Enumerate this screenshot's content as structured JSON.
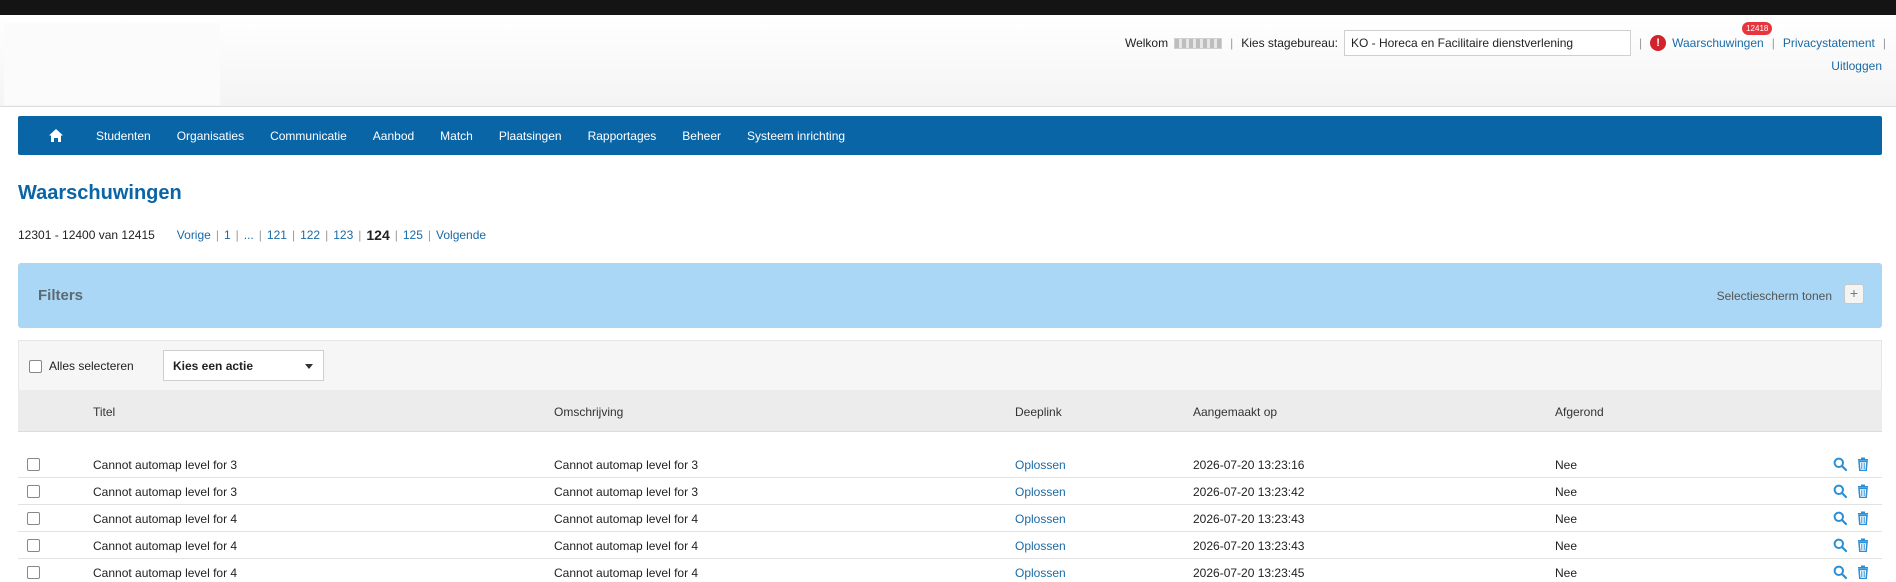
{
  "header": {
    "welcome_label": "Welkom",
    "bureau_label": "Kies stagebureau:",
    "bureau_value": "KO - Horeca en Facilitaire dienstverlening",
    "warnings_label": "Waarschuwingen",
    "warnings_count": "12418",
    "privacy_label": "Privacystatement",
    "logout_label": "Uitloggen"
  },
  "nav": {
    "home_icon": "home-icon",
    "items": [
      "Studenten",
      "Organisaties",
      "Communicatie",
      "Aanbod",
      "Match",
      "Plaatsingen",
      "Rapportages",
      "Beheer",
      "Systeem inrichting"
    ]
  },
  "page": {
    "title": "Waarschuwingen"
  },
  "pager": {
    "range": "12301 - 12400 van 12415",
    "prev": "Vorige",
    "first": "1",
    "ellipsis": "...",
    "pages": [
      "121",
      "122",
      "123"
    ],
    "current": "124",
    "after": "125",
    "next": "Volgende"
  },
  "filters": {
    "title": "Filters",
    "toggle_label": "Selectiescherm tonen",
    "plus_symbol": "+"
  },
  "actions": {
    "select_all_label": "Alles selecteren",
    "action_select_value": "Kies een actie"
  },
  "table": {
    "columns": {
      "titel": "Titel",
      "omschrijving": "Omschrijving",
      "deeplink": "Deeplink",
      "aangemaakt": "Aangemaakt op",
      "afgerond": "Afgerond"
    },
    "rows": [
      {
        "titel": "Cannot automap level for 3",
        "omschrijving": "Cannot automap level for 3",
        "deeplink": "Oplossen",
        "aangemaakt": "2026-07-20 13:23:16",
        "afgerond": "Nee"
      },
      {
        "titel": "Cannot automap level for 3",
        "omschrijving": "Cannot automap level for 3",
        "deeplink": "Oplossen",
        "aangemaakt": "2026-07-20 13:23:42",
        "afgerond": "Nee"
      },
      {
        "titel": "Cannot automap level for 4",
        "omschrijving": "Cannot automap level for 4",
        "deeplink": "Oplossen",
        "aangemaakt": "2026-07-20 13:23:43",
        "afgerond": "Nee"
      },
      {
        "titel": "Cannot automap level for 4",
        "omschrijving": "Cannot automap level for 4",
        "deeplink": "Oplossen",
        "aangemaakt": "2026-07-20 13:23:43",
        "afgerond": "Nee"
      },
      {
        "titel": "Cannot automap level for 4",
        "omschrijving": "Cannot automap level for 4",
        "deeplink": "Oplossen",
        "aangemaakt": "2026-07-20 13:23:45",
        "afgerond": "Nee"
      }
    ]
  },
  "colors": {
    "brand": "#0a65a6",
    "filters_bg": "#aad7f5",
    "link": "#1a6aa6",
    "warning": "#d0232b"
  }
}
